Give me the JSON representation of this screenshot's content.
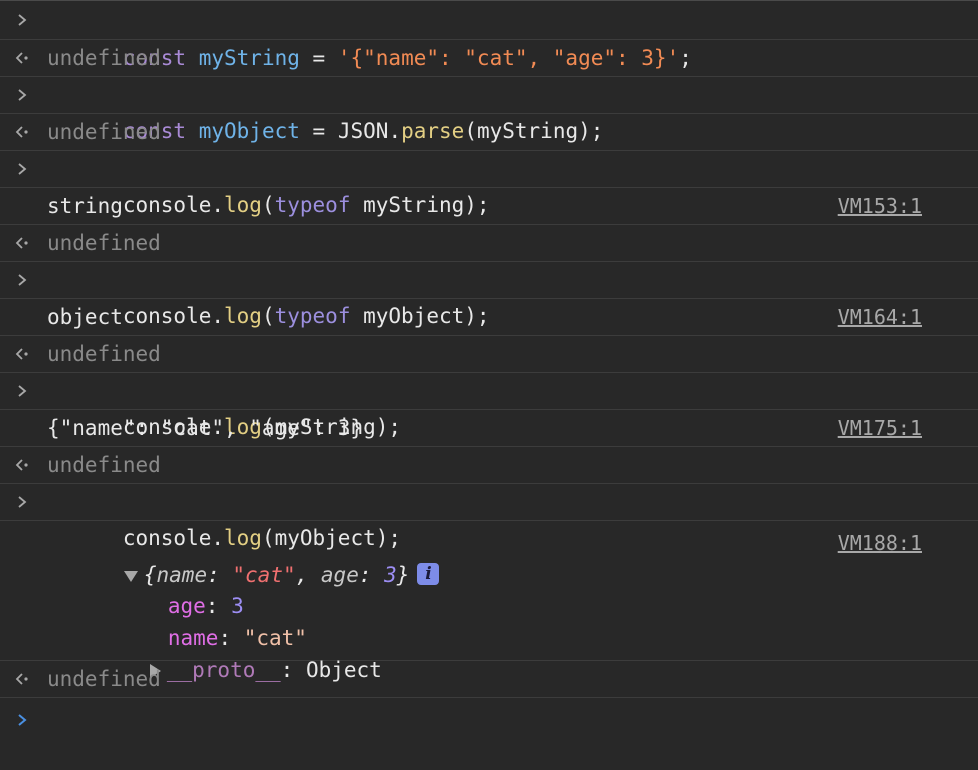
{
  "entries": {
    "e1": {
      "t1": "const",
      "t2": "myString",
      "t3": "=",
      "t4": "'{\"name\": \"cat\", \"age\": 3}'",
      "t5": ";"
    },
    "r1": "undefined",
    "e2": {
      "t1": "const",
      "t2": "myObject",
      "t3": "=",
      "t4": "JSON",
      "t5": ".",
      "t6": "parse",
      "t7": "(myString);"
    },
    "r2": "undefined",
    "e3": {
      "t1": "console.",
      "t2": "log",
      "t3": "(",
      "t4": "typeof",
      "t5": " myString);"
    },
    "o3": {
      "text": "string",
      "src": "VM153:1"
    },
    "r3": "undefined",
    "e4": {
      "t1": "console.",
      "t2": "log",
      "t3": "(",
      "t4": "typeof",
      "t5": " myObject);"
    },
    "o4": {
      "text": "object",
      "src": "VM164:1"
    },
    "r4": "undefined",
    "e5": {
      "t1": "console.",
      "t2": "log",
      "t3": "(myString);"
    },
    "o5": {
      "text": "{\"name\": \"cat\", \"age\": 3}",
      "src": "VM175:1"
    },
    "r5": "undefined",
    "e6": {
      "t1": "console.",
      "t2": "log",
      "t3": "(myObject);"
    },
    "o6": {
      "src": "VM188:1",
      "summary": {
        "open": "{",
        "k1": "name",
        "sep1": ": ",
        "v1": "\"cat\"",
        "comma": ", ",
        "k2": "age",
        "sep2": ": ",
        "v2": "3",
        "close": "}"
      },
      "info": "i",
      "props": [
        {
          "key": "age",
          "sep": ": ",
          "value": "3"
        },
        {
          "key": "name",
          "sep": ": ",
          "value": "\"cat\""
        }
      ],
      "proto": {
        "key": "__proto__",
        "sep": ": ",
        "value": "Object"
      }
    },
    "r6": "undefined"
  },
  "colors": {
    "background": "#282828",
    "prompt_active": "#4a90e2"
  },
  "icons": {
    "prompt": "chevron-right-icon",
    "result": "return-arrow-icon",
    "expand": "triangle-down-icon",
    "collapse": "triangle-right-icon",
    "info": "info-icon"
  }
}
